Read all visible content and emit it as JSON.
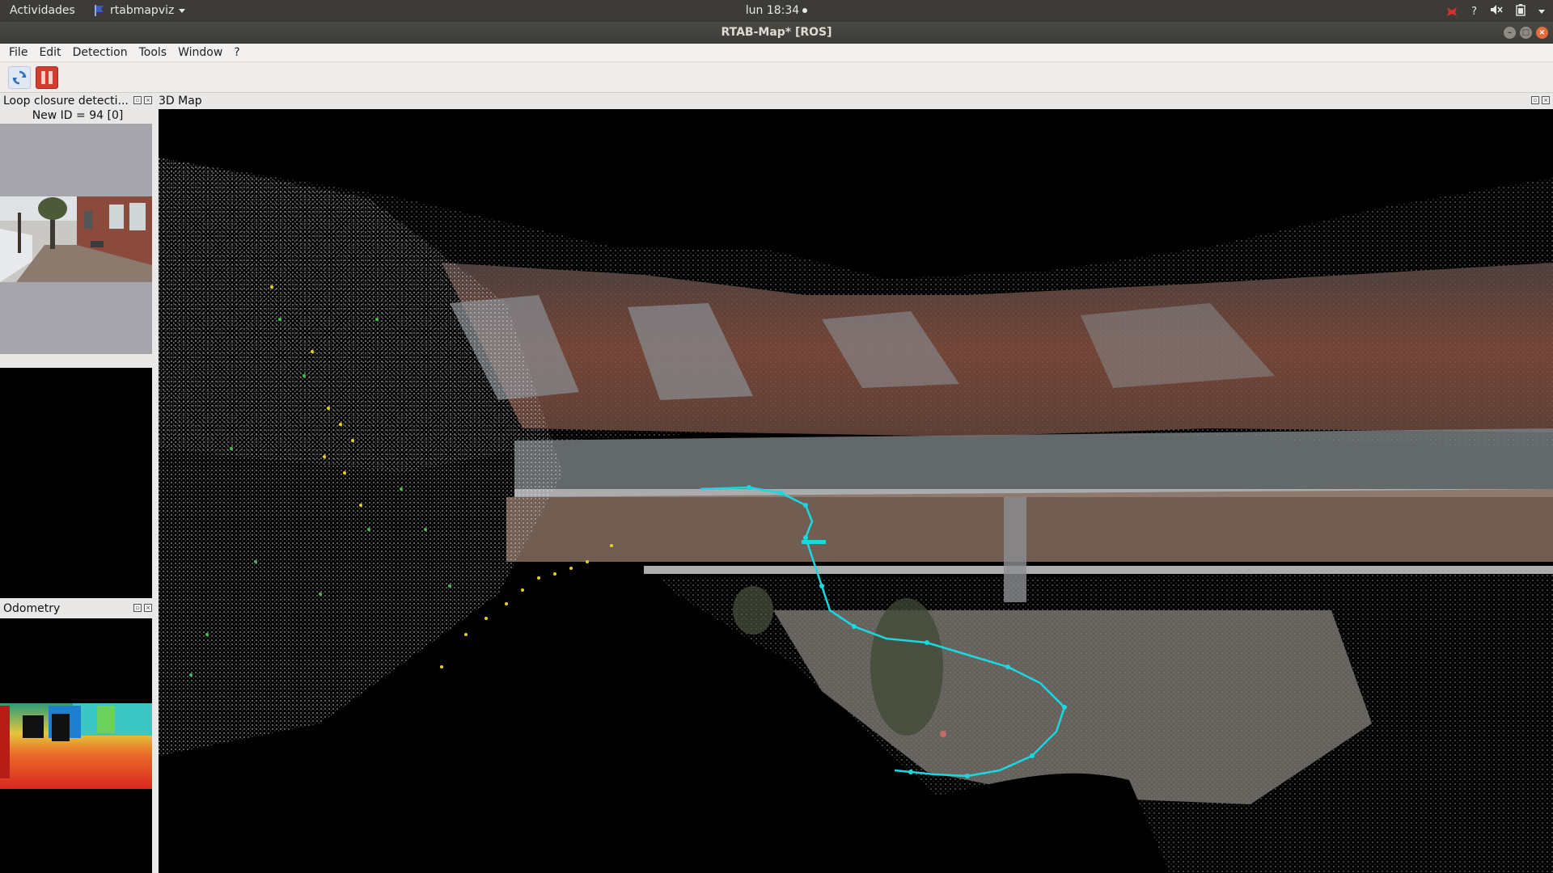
{
  "topbar": {
    "activities": "Actividades",
    "app_name": "rtabmapviz",
    "clock": "lun 18:34",
    "tray_help": "?",
    "tray_volume": "🔇",
    "tray_battery": "🔋"
  },
  "window": {
    "title": "RTAB-Map* [ROS]"
  },
  "menu": {
    "file": "File",
    "edit": "Edit",
    "detection": "Detection",
    "tools": "Tools",
    "window": "Window",
    "help": "?"
  },
  "docks": {
    "loop_closure": {
      "title": "Loop closure detecti...",
      "new_id": "New ID = 94 [0]"
    },
    "odometry": {
      "title": "Odometry"
    },
    "map": {
      "title": "3D Map"
    }
  },
  "colors": {
    "trajectory": "#19d8e0",
    "brick": "#8a5a48",
    "feature_yellow": "#e6d21a",
    "feature_green": "#3fbf3f"
  }
}
